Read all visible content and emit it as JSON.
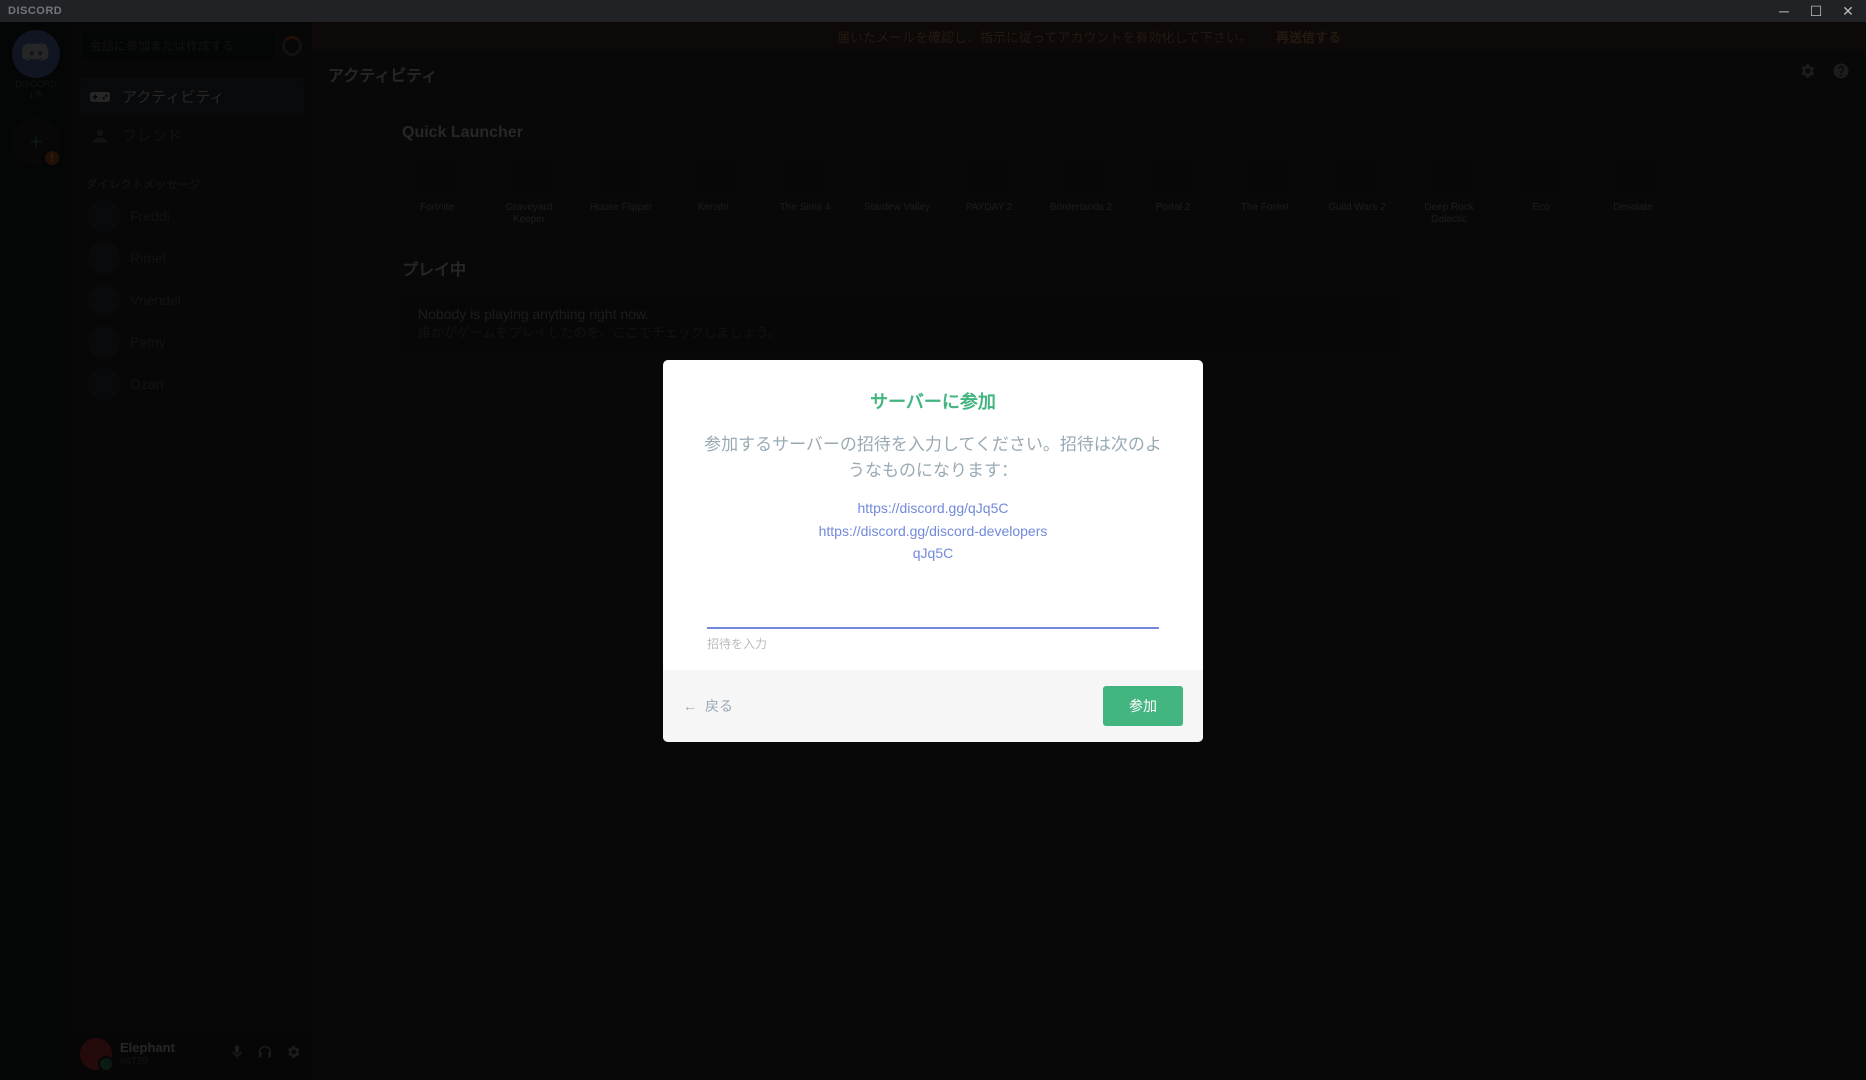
{
  "titlebar": {
    "logo": "DISCORD"
  },
  "guilds": {
    "home_label": "DISCORD",
    "online_label": "1件"
  },
  "channels": {
    "search_placeholder": "会話に参加または作成する",
    "nav": {
      "activity": "アクティビティ",
      "friends": "フレンド"
    },
    "dm_header": "ダイレクトメッセージ",
    "dms": [
      "Freddi",
      "Rimel",
      "Vriendel",
      "Pemy",
      "Ozan"
    ]
  },
  "user": {
    "name": "Elephant",
    "tag": "#4729"
  },
  "banner": {
    "text": "届いたメールを確認し、指示に従ってアカウントを有効化して下さい。",
    "resend": "再送信する"
  },
  "header": {
    "title": "アクティビティ"
  },
  "launcher": {
    "title": "Quick Launcher",
    "items": [
      "Fortnite",
      "Graveyard Keeper",
      "House Flipper",
      "Kenshi",
      "The Sims 4",
      "Stardew Valley",
      "PAYDAY 2",
      "Borderlands 2",
      "Portal 2",
      "The Forest",
      "Guild Wars 2",
      "Deep Rock Galactic",
      "Eco",
      "Desolate"
    ]
  },
  "playing": {
    "title": "プレイ中",
    "empty_l1": "Nobody is playing anything right now.",
    "empty_l2": "誰かがゲームをプレイしたのを、ここでチェックしましょう。"
  },
  "modal": {
    "title": "サーバーに参加",
    "desc": "参加するサーバーの招待を入力してください。招待は次のようなものになります：",
    "examples": [
      "https://discord.gg/qJq5C",
      "https://discord.gg/discord-developers",
      "qJq5C"
    ],
    "input_label": "招待を入力",
    "back": "戻る",
    "join": "参加"
  }
}
